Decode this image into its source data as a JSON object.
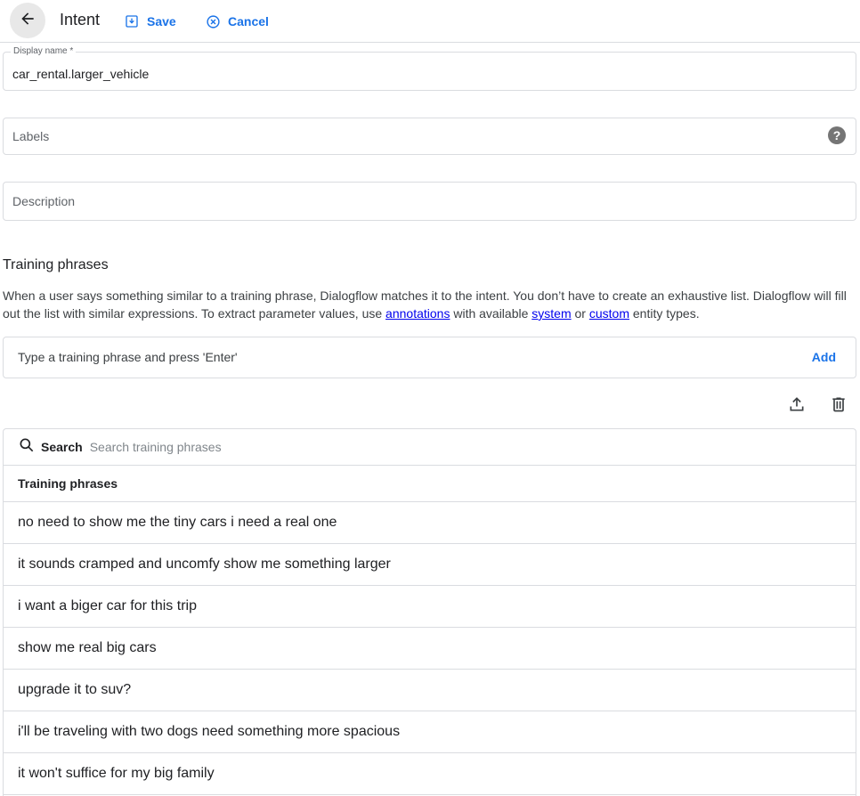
{
  "header": {
    "back_icon": "arrow-left-icon",
    "title": "Intent",
    "save_label": "Save",
    "save_icon": "save-icon",
    "cancel_label": "Cancel",
    "cancel_icon": "cancel-circle-icon"
  },
  "form": {
    "display_name": {
      "label": "Display name *",
      "value": "car_rental.larger_vehicle"
    },
    "labels": {
      "placeholder": "Labels",
      "help_icon": "help-icon"
    },
    "description": {
      "placeholder": "Description"
    }
  },
  "training": {
    "title": "Training phrases",
    "description_part1": "When a user says something similar to a training phrase, Dialogflow matches it to the intent. You don’t have to create an exhaustive list. Dialogflow will fill out the list with similar expressions. To extract parameter values, use ",
    "link_annotations": "annotations",
    "description_part2": " with available ",
    "link_system": "system",
    "description_part3": " or ",
    "link_custom": "custom",
    "description_part4": " entity types.",
    "input_placeholder": "Type a training phrase and press 'Enter'",
    "add_label": "Add",
    "upload_icon": "upload-icon",
    "delete_icon": "trash-icon"
  },
  "table": {
    "search_label": "Search",
    "search_placeholder": "Search training phrases",
    "column_header": "Training phrases",
    "rows": [
      "no need to show me the tiny cars i need a real one",
      "it sounds cramped and uncomfy show me something larger",
      "i want a biger car for this trip",
      "show me real big cars",
      "upgrade it to suv?",
      "i'll be traveling with two dogs need something more spacious",
      "it won't suffice for my big family"
    ]
  },
  "colors": {
    "accent": "#1a73e8",
    "link": "#0000ee",
    "border": "#dadce0"
  }
}
